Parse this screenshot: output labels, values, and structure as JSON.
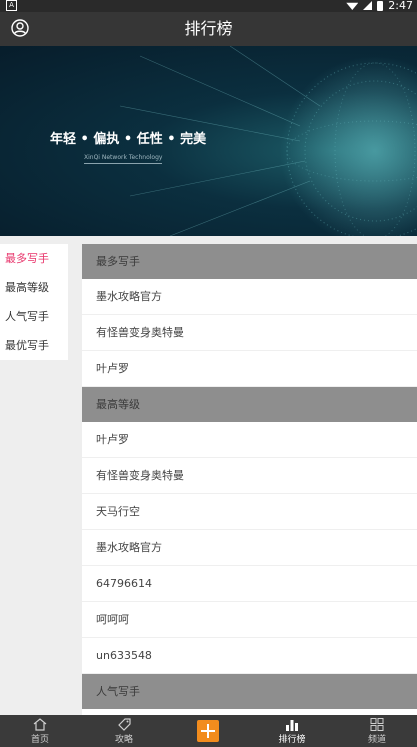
{
  "status": {
    "time": "2:47",
    "left_badge": "A"
  },
  "header": {
    "title": "排行榜"
  },
  "banner": {
    "title": "年轻 • 偏执 • 任性 • 完美",
    "subtitle": "XinQi Network Technology"
  },
  "sidebar": {
    "items": [
      {
        "label": "最多写手"
      },
      {
        "label": "最高等级"
      },
      {
        "label": "人气写手"
      },
      {
        "label": "最优写手"
      }
    ]
  },
  "groups": [
    {
      "title": "最多写手",
      "rows": [
        "墨水攻略官方",
        "有怪兽变身奥特曼",
        "叶卢罗"
      ]
    },
    {
      "title": "最高等级",
      "rows": [
        "叶卢罗",
        "有怪兽变身奥特曼",
        "天马行空",
        "墨水攻略官方",
        "64796614",
        "呵呵呵",
        "un633548"
      ]
    },
    {
      "title": "人气写手",
      "rows": []
    }
  ],
  "tabbar": {
    "items": [
      {
        "label": "首页"
      },
      {
        "label": "攻略"
      },
      {
        "label": "排行榜"
      },
      {
        "label": "频道"
      }
    ]
  },
  "colors": {
    "accent": "#e8336a",
    "plus": "#f28c1d",
    "appbar": "#363636"
  }
}
